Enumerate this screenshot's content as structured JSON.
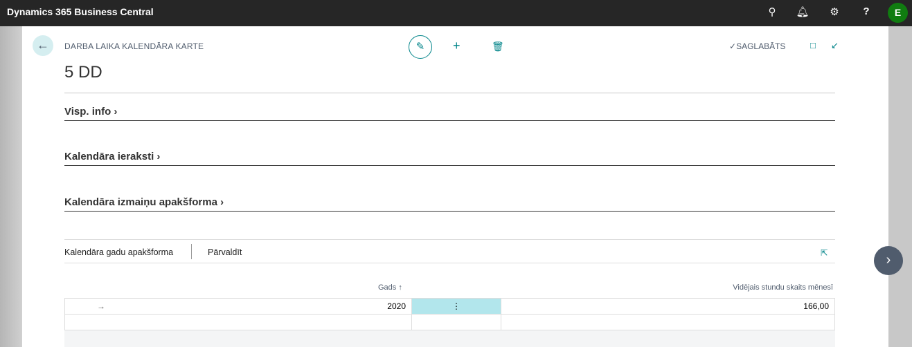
{
  "topbar": {
    "app_title": "Dynamics 365 Business Central",
    "avatar_initial": "E",
    "help": "?"
  },
  "page": {
    "breadcrumb": "DARBA LAIKA KALENDĀRA KARTE",
    "title": "5 DD",
    "saved_status": "SAGLABĀTS"
  },
  "sections": [
    {
      "label": "Visp. info"
    },
    {
      "label": "Kalendāra ieraksti"
    },
    {
      "label": "Kalendāra izmaiņu apakšforma"
    }
  ],
  "subform": {
    "title": "Kalendāra gadu apakšforma",
    "action": "Pārvaldīt",
    "columns": {
      "year": "Gads",
      "avg_hours": "Vidējais stundu skaits mēnesī"
    },
    "rows": [
      {
        "year": "2020",
        "avg_hours": "166,00"
      }
    ]
  },
  "colors": {
    "accent": "#008489",
    "topbar": "#262626",
    "selected_cell": "#b2e6ec"
  }
}
